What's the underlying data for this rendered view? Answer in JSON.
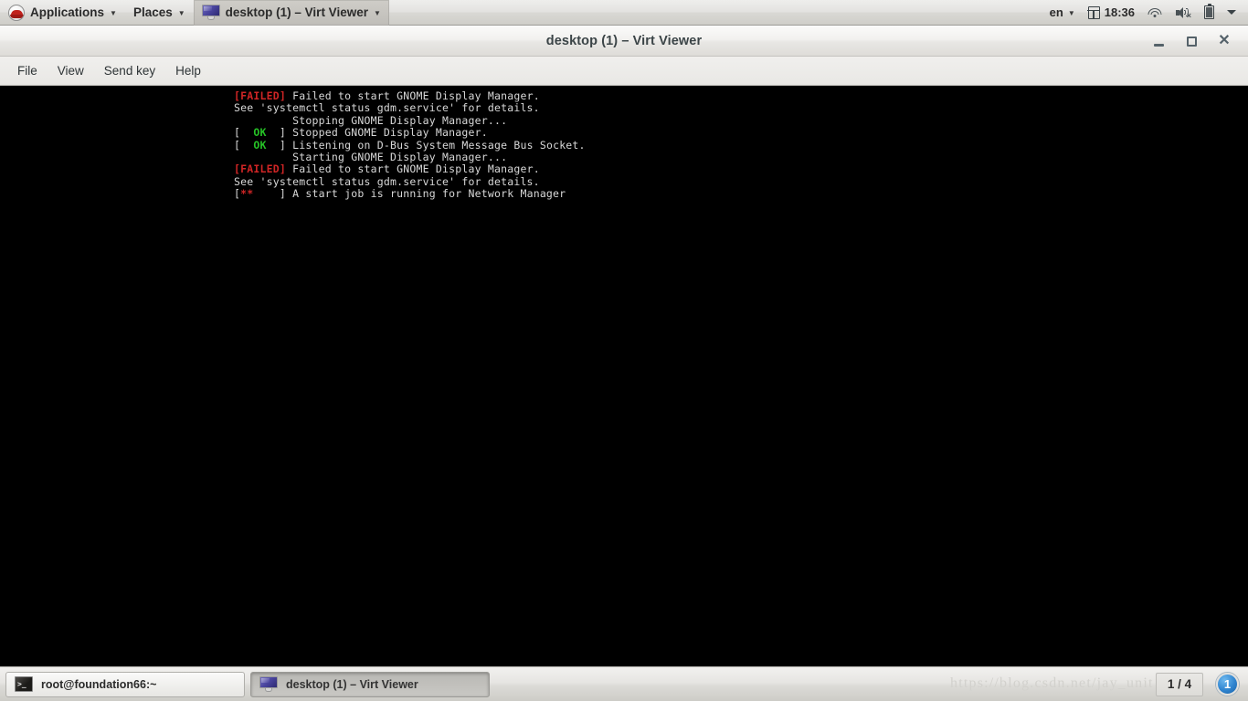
{
  "top_panel": {
    "applications_label": "Applications",
    "places_label": "Places",
    "window_button_label": "desktop (1) – Virt Viewer",
    "keyboard_layout": "en",
    "clock": "18:36",
    "icons": {
      "menu_logo": "redhat-logo",
      "window_icon": "monitor-icon",
      "calendar": "calendar-icon",
      "network": "wifi-icon",
      "volume": "speaker-muted-icon",
      "battery": "battery-icon",
      "overflow": "chevron-down-icon"
    }
  },
  "window": {
    "title": "desktop (1) – Virt Viewer",
    "buttons": {
      "minimize": "–",
      "maximize": "□",
      "close": "✕"
    },
    "menu": [
      "File",
      "View",
      "Send key",
      "Help"
    ]
  },
  "console": {
    "lines": [
      {
        "segments": [
          {
            "text": "[FAILED]",
            "color": "red"
          },
          {
            "text": " Failed to start GNOME Display Manager.",
            "color": "white"
          }
        ]
      },
      {
        "segments": [
          {
            "text": "See 'systemctl status gdm.service' for details.",
            "color": "white"
          }
        ]
      },
      {
        "segments": [
          {
            "text": "         Stopping GNOME Display Manager...",
            "color": "white"
          }
        ]
      },
      {
        "segments": [
          {
            "text": "[ ",
            "color": "white"
          },
          {
            "text": " OK ",
            "color": "green"
          },
          {
            "text": " ] Stopped GNOME Display Manager.",
            "color": "white"
          }
        ]
      },
      {
        "segments": [
          {
            "text": "[ ",
            "color": "white"
          },
          {
            "text": " OK ",
            "color": "green"
          },
          {
            "text": " ] Listening on D-Bus System Message Bus Socket.",
            "color": "white"
          }
        ]
      },
      {
        "segments": [
          {
            "text": "         Starting GNOME Display Manager...",
            "color": "white"
          }
        ]
      },
      {
        "segments": [
          {
            "text": "[FAILED]",
            "color": "red"
          },
          {
            "text": " Failed to start GNOME Display Manager.",
            "color": "white"
          }
        ]
      },
      {
        "segments": [
          {
            "text": "See 'systemctl status gdm.service' for details.",
            "color": "white"
          }
        ]
      },
      {
        "segments": [
          {
            "text": "[",
            "color": "white"
          },
          {
            "text": "**",
            "color": "red"
          },
          {
            "text": "    ] A start job is running for Network Manager",
            "color": "white"
          }
        ]
      }
    ]
  },
  "taskbar": {
    "tasks": [
      {
        "label": "root@foundation66:~",
        "icon": "terminal-icon",
        "active": false
      },
      {
        "label": "desktop (1) – Virt Viewer",
        "icon": "monitor-icon",
        "active": true
      }
    ],
    "watermark": "https://blog.csdn.net/jay_unit",
    "workspace_indicator": "1 / 4",
    "notification_count": "1"
  },
  "colors": {
    "terminal_bg": "#000000",
    "terminal_fg": "#cfcfcf",
    "status_ok": "#26c226",
    "status_failed": "#cf2525",
    "panel_bg": "#e6e5e2",
    "accent_blue": "#2f84cf"
  }
}
